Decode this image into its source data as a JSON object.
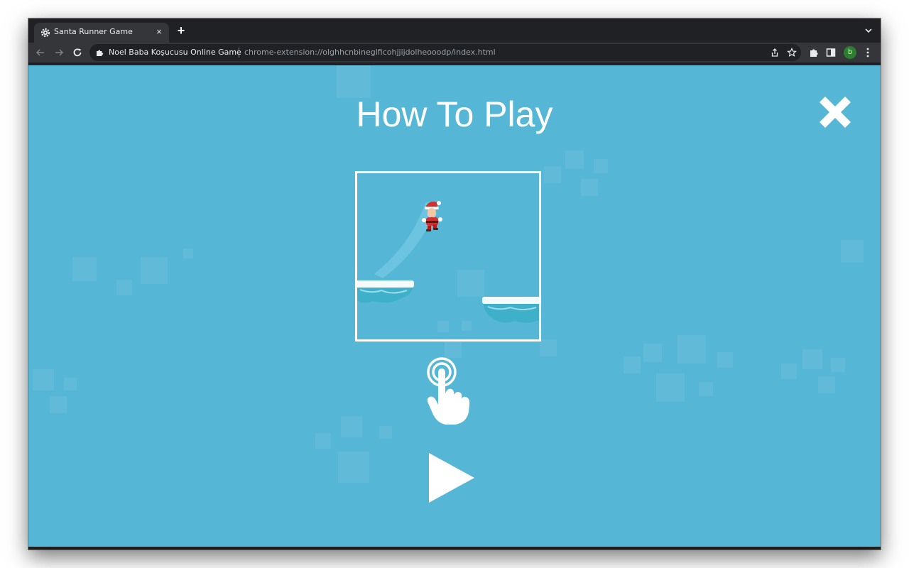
{
  "browser": {
    "tab": {
      "title": "Santa Runner Game",
      "favicon": "gear-icon",
      "close_glyph": "×"
    },
    "new_tab_glyph": "+",
    "omnibox": {
      "site_name": "Noel Baba Koşucusu Online Game",
      "url": "chrome-extension://olghhcnbineglficohjjijdolheooodp/index.html"
    },
    "profile_initial": "b",
    "colors": {
      "tabstrip": "#202124",
      "toolbar": "#35363a",
      "omnibox": "#202124",
      "profile": "#2e7d32"
    }
  },
  "game": {
    "screen_title": "How To Play",
    "background_color": "#55b6d6",
    "icons": {
      "close": "close-x-icon",
      "tap": "tap-hand-icon",
      "play": "play-icon",
      "character": "santa-character"
    }
  }
}
